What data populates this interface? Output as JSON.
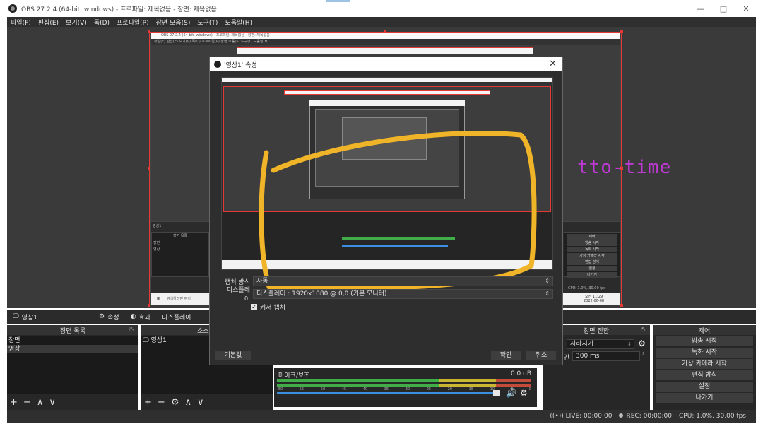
{
  "titlebar": {
    "title": "OBS 27.2.4 (64-bit, windows) - 프로파일: 제목없음 - 장면: 제목없음",
    "minimize": "—",
    "maximize": "□",
    "close": "✕"
  },
  "menu": [
    "파일(F)",
    "편집(E)",
    "보기(V)",
    "독(D)",
    "프로파일(P)",
    "장면 모음(S)",
    "도구(T)",
    "도움말(H)"
  ],
  "watermark": "tto-time",
  "scenebar": {
    "scene_name": "영상1",
    "properties": "속성",
    "filters": "효과",
    "display": "디스플레이"
  },
  "scenes_dock": {
    "title": "장면 목록",
    "items": [
      "장면",
      "영상"
    ]
  },
  "sources_dock": {
    "title": "소스 목",
    "items": [
      "영상1"
    ]
  },
  "transitions_dock": {
    "title": "장면 전환",
    "type": "사라지기",
    "duration_label": "간",
    "duration": "300 ms"
  },
  "controls_dock": {
    "title": "제어",
    "buttons": [
      "방송 시작",
      "녹화 시작",
      "가상 카메라 시작",
      "편집 방식",
      "설정",
      "나가기"
    ]
  },
  "mixer": {
    "channel": "마이크/보조",
    "db": "0.0 dB",
    "ticks": [
      "-60",
      "-55",
      "-50",
      "-45",
      "-40",
      "-35",
      "-30",
      "-25",
      "-20",
      "-15",
      "-10",
      "-5",
      "0"
    ]
  },
  "status": {
    "live": "LIVE: 00:00:00",
    "rec": "REC: 00:00:00",
    "cpu": "CPU: 1.0%, 30.00 fps"
  },
  "dialog": {
    "title": "'영상1' 속성",
    "close": "✕",
    "capture_label": "캡처 방식",
    "capture_value": "자동",
    "display_label": "디스플레이",
    "display_value": "디스플레이 : 1920x1080 @ 0,0 (기본 모니터)",
    "cursor_label": "커서 캡처",
    "defaults_btn": "기본값",
    "ok_btn": "확인",
    "cancel_btn": "취소"
  },
  "inner": {
    "title": "OBS 27.2.4 (64-bit, windows) - 프로파일: 제목없음 - 장면: 제목없음",
    "menu": "파일(F)  편집(E)  보기(V)  독(D)  프로파일(P)  장면 모음(S)  도구(T)  도움말(H)",
    "scene": "영상1",
    "scenes_header": "장면 목록",
    "scene_rows": [
      "장면",
      "영상"
    ],
    "search": "검색하려면 여기",
    "clock_time": "오전 11:29",
    "clock_date": "2022-06-08",
    "cpu": "CPU: 1.0%, 30.00 fps",
    "controls": [
      "제어",
      "방송 시작",
      "녹화 시작",
      "가상 카메라 시작",
      "편집 방식",
      "설정",
      "나가기"
    ]
  },
  "colors": {
    "highlight_yellow": "#f0b429",
    "selection_red": "#e53935",
    "watermark_purple": "#c039d6"
  }
}
